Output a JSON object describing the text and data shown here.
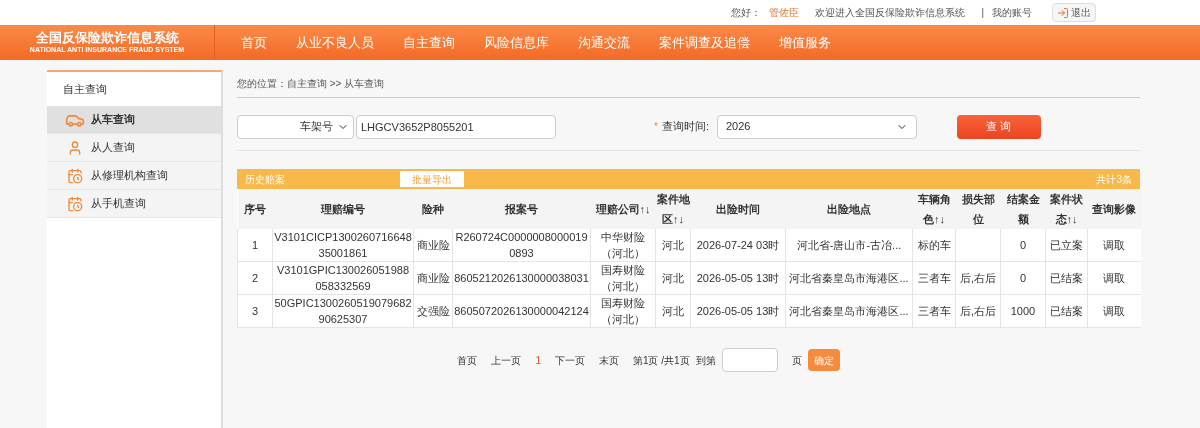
{
  "top_bar": {
    "greeting": "您好：",
    "user_name": "管佐臣",
    "welcome": "欢迎进入全国反保险欺诈信息系统",
    "separator": "|",
    "account_link": "我的账号",
    "logout_button": "退出"
  },
  "header": {
    "logo_title": "全国反保险欺诈信息系统",
    "logo_subtitle": "NATIONAL ANTI INSURANCE FRAUD SYSTEM",
    "nav": [
      "首页",
      "从业不良人员",
      "自主查询",
      "风险信息库",
      "沟通交流",
      "案件调查及追偿",
      "增值服务"
    ]
  },
  "sidebar": {
    "title": "自主查询",
    "items": [
      {
        "label": "从车查询",
        "kind": "car",
        "selected": true
      },
      {
        "label": "从人查询",
        "kind": "person",
        "selected": false
      },
      {
        "label": "从修理机构查询",
        "kind": "calendar",
        "selected": false
      },
      {
        "label": "从手机查询",
        "kind": "calendar",
        "selected": false
      }
    ]
  },
  "breadcrumb": "您的位置：自主查询 >> 从车查询",
  "search": {
    "type_select": "车架号",
    "value": "LHGCV3652P8055201",
    "required_mark": "*",
    "time_label": "查询时间:",
    "time_select": "2026",
    "button": "查 询"
  },
  "table": {
    "caption": "历史赔案",
    "export_button": "批量导出",
    "total": "共计3条",
    "columns": [
      "序号",
      "理赔编号",
      "险种",
      "报案号",
      "理赔公司↑↓",
      "案件地区↑↓",
      "出险时间",
      "出险地点",
      "车辆角色↑↓",
      "损失部位",
      "结案金额",
      "案件状态↑↓",
      "查询影像"
    ],
    "rows": [
      [
        "1",
        "V3101CICP130026071664835001861",
        "商业险",
        "R260724C00000080000190893",
        "中华财险（河北）",
        "河北",
        "2026-07-24 03时",
        "河北省-唐山市-古冶...",
        "标的车",
        "",
        "0",
        "已立案",
        "调取"
      ],
      [
        "2",
        "V3101GPIC130026051988058332569",
        "商业险",
        "8605212026130000038031",
        "国寿财险（河北）",
        "河北",
        "2026-05-05 13时",
        "河北省秦皇岛市海港区...",
        "三者车",
        "后,右后",
        "0",
        "已结案",
        "调取"
      ],
      [
        "3",
        "50GPIC130026051907968290625307",
        "交强险",
        "8605072026130000042124",
        "国寿财险（河北）",
        "河北",
        "2026-05-05 13时",
        "河北省秦皇岛市海港区...",
        "三者车",
        "后,右后",
        "1000",
        "已结案",
        "调取"
      ]
    ]
  },
  "pagination": {
    "first": "首页",
    "prev": "上一页",
    "pages": [
      {
        "label": "1",
        "selected": true
      }
    ],
    "next": "下一页",
    "last": "末页",
    "info": "第1页 /共1页",
    "goto_label": "到第",
    "page_unit": "页",
    "confirm_button": "确定"
  }
}
